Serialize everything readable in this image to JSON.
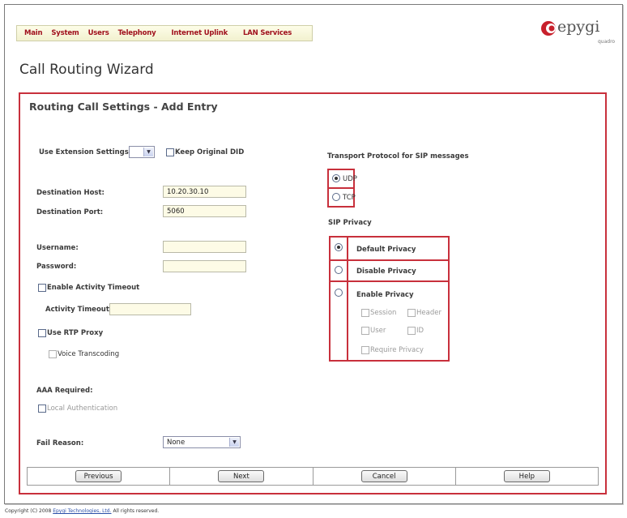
{
  "menu": {
    "items": [
      "Main",
      "System",
      "Users",
      "Telephony",
      "Internet Uplink",
      "LAN Services"
    ]
  },
  "logo": {
    "brand": "epygi",
    "sub": "quadro"
  },
  "page_title": "Call Routing Wizard",
  "panel_title": "Routing Call Settings - Add Entry",
  "form": {
    "use_extension_label": "Use Extension Settings:",
    "use_extension_value": "",
    "keep_original_did_label": "Keep Original DID",
    "destination_host_label": "Destination Host:",
    "destination_host_value": "10.20.30.10",
    "destination_port_label": "Destination Port:",
    "destination_port_value": "5060",
    "username_label": "Username:",
    "username_value": "",
    "password_label": "Password:",
    "password_value": "",
    "enable_activity_timeout_label": "Enable Activity Timeout",
    "activity_timeout_label": "Activity Timeout:",
    "activity_timeout_value": "",
    "use_rtp_proxy_label": "Use RTP Proxy",
    "voice_transcoding_label": "Voice Transcoding",
    "aaa_required_label": "AAA Required:",
    "local_authentication_label": "Local Authentication",
    "fail_reason_label": "Fail Reason:",
    "fail_reason_value": "None"
  },
  "transport": {
    "label": "Transport Protocol for SIP messages",
    "options": [
      "UDP",
      "TCP"
    ],
    "selected": "UDP"
  },
  "privacy": {
    "label": "SIP Privacy",
    "default_label": "Default Privacy",
    "disable_label": "Disable Privacy",
    "enable_label": "Enable Privacy",
    "selected": "Default Privacy",
    "session_label": "Session",
    "header_label": "Header",
    "user_label": "User",
    "id_label": "ID",
    "require_label": "Require Privacy"
  },
  "buttons": {
    "previous": "Previous",
    "next": "Next",
    "cancel": "Cancel",
    "help": "Help"
  },
  "footer": {
    "prefix": "Copyright (C) 2008",
    "company": "Epygi Technologies, Ltd.",
    "suffix": "All rights reserved."
  },
  "colors": {
    "accent_red": "#c8303c",
    "menu_text": "#a0101c",
    "input_bg": "#fdfbe6"
  }
}
